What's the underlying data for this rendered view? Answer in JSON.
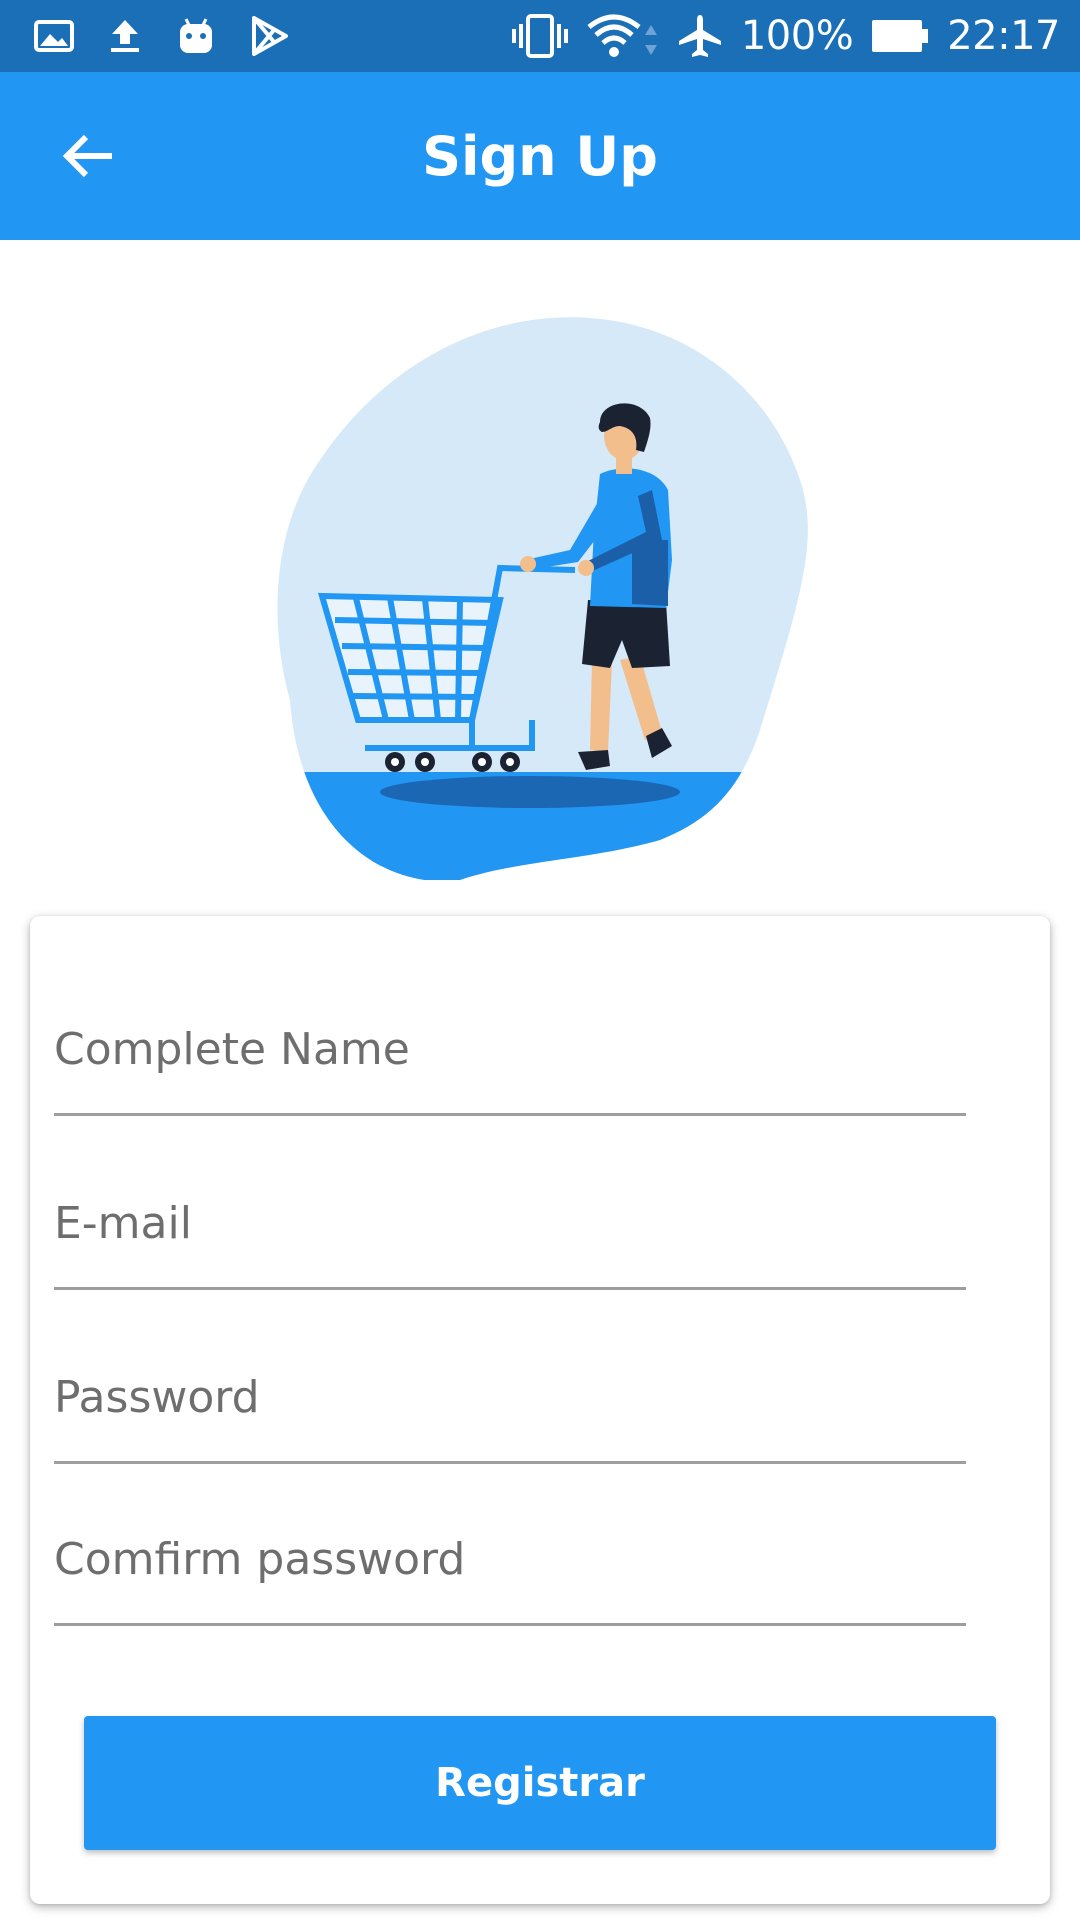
{
  "status_bar": {
    "battery": "100%",
    "time": "22:17",
    "icons": [
      "image-icon",
      "upload-icon",
      "android-icon",
      "play-store-icon",
      "vibrate-icon",
      "wifi-icon",
      "airplane-icon",
      "battery-icon"
    ]
  },
  "app_bar": {
    "title": "Sign Up",
    "back_icon": "arrow-left-icon"
  },
  "illustration": {
    "description_icon": "shopping-cart-illustration"
  },
  "form": {
    "fields": [
      {
        "placeholder": "Complete Name",
        "value": ""
      },
      {
        "placeholder": "E-mail",
        "value": ""
      },
      {
        "placeholder": "Password",
        "value": ""
      },
      {
        "placeholder": "Comfirm password",
        "value": ""
      }
    ],
    "submit_label": "Registrar"
  },
  "colors": {
    "status_bar": "#1a6fb6",
    "primary": "#2196f3",
    "blob": "#d6e9f8"
  }
}
